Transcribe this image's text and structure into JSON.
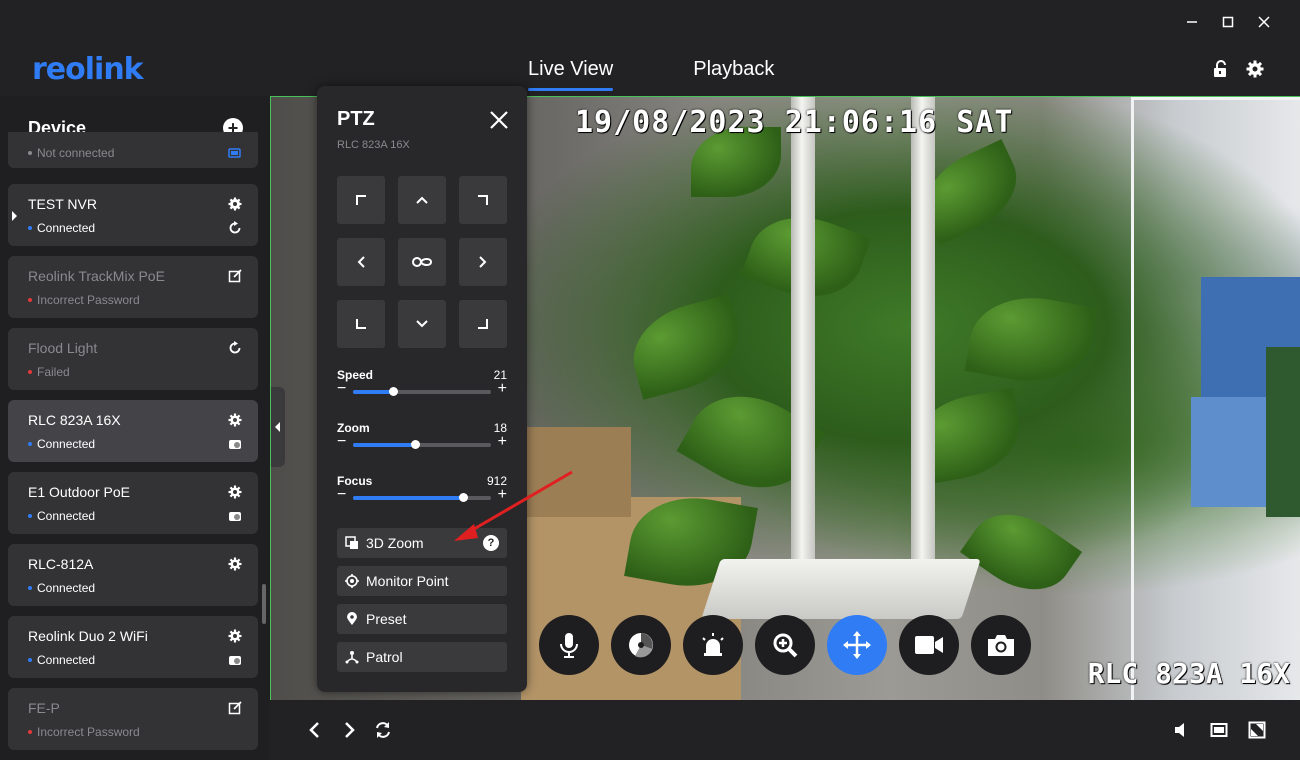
{
  "app": {
    "logo_text": "reolink",
    "brand_color": "#2f7cf5"
  },
  "window_controls": [
    "minimize-icon",
    "maximize-icon",
    "close-icon"
  ],
  "tabs": [
    {
      "label": "Live View",
      "active": true
    },
    {
      "label": "Playback",
      "active": false
    }
  ],
  "header_icons": [
    "unlock-icon",
    "gear-icon"
  ],
  "sidebar": {
    "title": "Device",
    "devices": [
      {
        "name": "",
        "status": "Not connected",
        "status_color": "#8a8a8e",
        "action": "battery-icon",
        "dim": true
      },
      {
        "name": "TEST NVR",
        "status": "Connected",
        "status_color": "#2f7cf5",
        "action": "gear-icon",
        "action2": "refresh-icon",
        "dim": false
      },
      {
        "name": "Reolink TrackMix PoE",
        "status": "Incorrect Password",
        "status_color": "#e03a3a",
        "action": "edit-icon",
        "dim": true
      },
      {
        "name": "Flood Light",
        "status": "Failed",
        "status_color": "#e03a3a",
        "action": "refresh-icon",
        "dim": true
      },
      {
        "name": "RLC 823A 16X",
        "status": "Connected",
        "status_color": "#2f7cf5",
        "action": "gear-icon",
        "action2": "camera-toggle-icon",
        "dim": false,
        "selected": true
      },
      {
        "name": "E1 Outdoor PoE",
        "status": "Connected",
        "status_color": "#2f7cf5",
        "action": "gear-icon",
        "action2": "camera-toggle-icon",
        "dim": false
      },
      {
        "name": "RLC-812A",
        "status": "Connected",
        "status_color": "#2f7cf5",
        "action": "gear-icon",
        "dim": false
      },
      {
        "name": "Reolink Duo 2 WiFi",
        "status": "Connected",
        "status_color": "#2f7cf5",
        "action": "gear-icon",
        "action2": "camera-toggle-icon",
        "dim": false
      },
      {
        "name": "FE-P",
        "status": "Incorrect Password",
        "status_color": "#e03a3a",
        "action": "edit-icon",
        "dim": true
      }
    ]
  },
  "video": {
    "osd_datetime": "19/08/2023 21:06:16 SAT",
    "osd_camera_name": "RLC 823A 16X",
    "controls": [
      {
        "icon": "microphone-icon",
        "active": false
      },
      {
        "icon": "color-wheel-icon",
        "active": false
      },
      {
        "icon": "siren-icon",
        "active": false
      },
      {
        "icon": "zoom-in-icon",
        "active": false
      },
      {
        "icon": "ptz-move-icon",
        "active": true
      },
      {
        "icon": "record-icon",
        "active": false
      },
      {
        "icon": "snapshot-icon",
        "active": false
      }
    ]
  },
  "ptz": {
    "title": "PTZ",
    "subtitle": "RLC 823A 16X",
    "sliders": [
      {
        "label": "Speed",
        "value": "21",
        "fraction": 0.29
      },
      {
        "label": "Zoom",
        "value": "18",
        "fraction": 0.45
      },
      {
        "label": "Focus",
        "value": "912",
        "fraction": 0.8
      }
    ],
    "buttons": [
      {
        "label": "3D Zoom",
        "icon": "3d-zoom-icon",
        "help": "?"
      },
      {
        "label": "Monitor Point",
        "icon": "target-icon"
      },
      {
        "label": "Preset",
        "icon": "location-pin-icon"
      },
      {
        "label": "Patrol",
        "icon": "patrol-icon"
      }
    ]
  },
  "bottom_bar": {
    "left_icons": [
      "previous-icon",
      "next-icon",
      "sync-icon"
    ],
    "right_icons": [
      "volume-icon",
      "window-icon",
      "fullscreen-icon"
    ]
  }
}
